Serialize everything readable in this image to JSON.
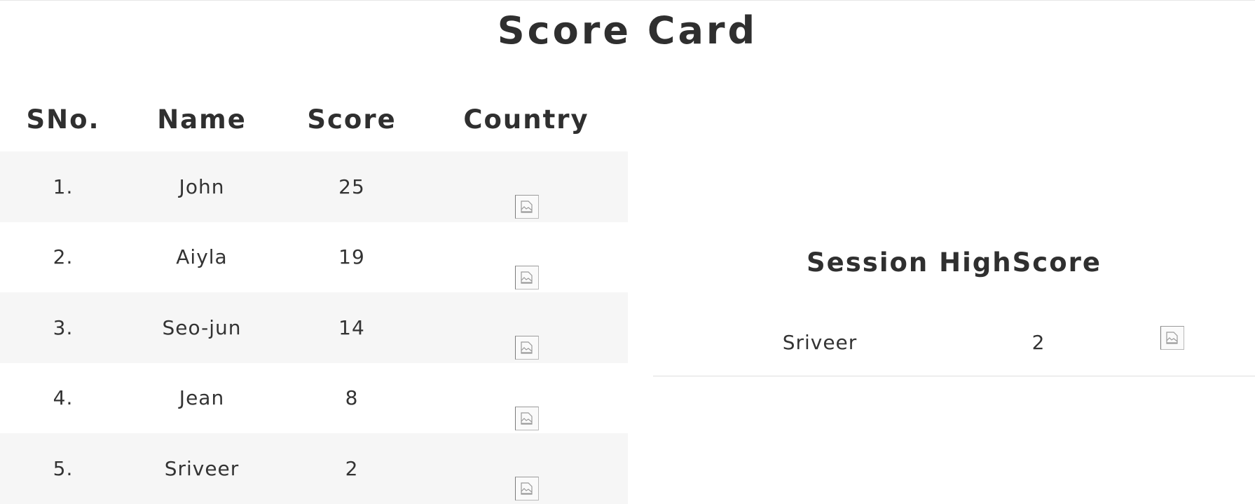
{
  "title": "Score Card",
  "table": {
    "headers": {
      "sno": "SNo.",
      "name": "Name",
      "score": "Score",
      "country": "Country"
    },
    "rows": [
      {
        "sno": "1.",
        "name": "John",
        "score": "25",
        "country_icon": "broken-image-icon"
      },
      {
        "sno": "2.",
        "name": "Aiyla",
        "score": "19",
        "country_icon": "broken-image-icon"
      },
      {
        "sno": "3.",
        "name": "Seo-jun",
        "score": "14",
        "country_icon": "broken-image-icon"
      },
      {
        "sno": "4.",
        "name": "Jean",
        "score": "8",
        "country_icon": "broken-image-icon"
      },
      {
        "sno": "5.",
        "name": "Sriveer",
        "score": "2",
        "country_icon": "broken-image-icon"
      }
    ]
  },
  "session": {
    "title": "Session HighScore",
    "name": "Sriveer",
    "score": "2",
    "country_icon": "broken-image-icon"
  },
  "colors": {
    "text": "#2f2f2f",
    "stripe": "#f6f6f6",
    "divider": "#dedede"
  }
}
